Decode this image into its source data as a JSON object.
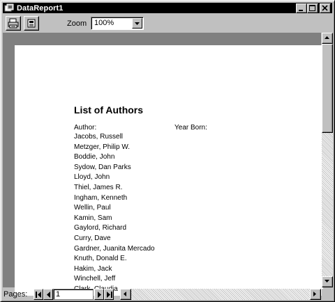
{
  "window": {
    "title": "DataReport1",
    "controls": [
      "minimize-icon",
      "maximize-icon",
      "close-icon"
    ]
  },
  "toolbar": {
    "print_icon": "printer-icon",
    "export_icon": "export-icon",
    "zoom_label": "Zoom",
    "zoom_value": "100%"
  },
  "report": {
    "title": "List of Authors",
    "col_author": "Author:",
    "col_year": "Year Born:",
    "authors": [
      "Jacobs, Russell",
      "Metzger, Philip W.",
      "Boddie, John",
      "Sydow, Dan Parks",
      "Lloyd, John",
      "Thiel, James R.",
      "Ingham, Kenneth",
      "Wellin, Paul",
      "Kamin, Sam",
      "Gaylord, Richard",
      "Curry, Dave",
      "Gardner, Juanita Mercado",
      "Knuth, Donald E.",
      "Hakim, Jack",
      "Winchell, Jeff",
      "Clark, Claudia"
    ]
  },
  "footer": {
    "pages_label": "Pages:",
    "page_number": "1"
  }
}
